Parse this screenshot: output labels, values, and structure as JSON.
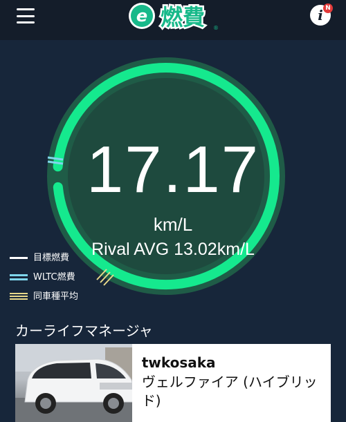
{
  "header": {
    "menu_icon": "hamburger-menu-icon",
    "logo_text": "燃費",
    "logo_mark": "e",
    "logo_registered": "®",
    "info_icon": "i",
    "info_badge": "N"
  },
  "gauge": {
    "value": "17.17",
    "unit": "km/L",
    "rival_text": "Rival AVG 13.02km/L",
    "progress_fraction": 0.97,
    "colors": {
      "track": "#1f5c47",
      "progress": "#15e98e",
      "wltc_marker": "#7fd6ec",
      "average_marker": "#e8d98a"
    }
  },
  "legend": [
    {
      "label": "目標燃費",
      "icon": "target-line-icon"
    },
    {
      "label": "WLTC燃費",
      "icon": "wltc-line-icon"
    },
    {
      "label": "同車種平均",
      "icon": "average-line-icon"
    }
  ],
  "car_life": {
    "section_title": "カーライフマネージャ",
    "owner": "twkosaka",
    "model": "ヴェルファイア (ハイブリッド)"
  }
}
